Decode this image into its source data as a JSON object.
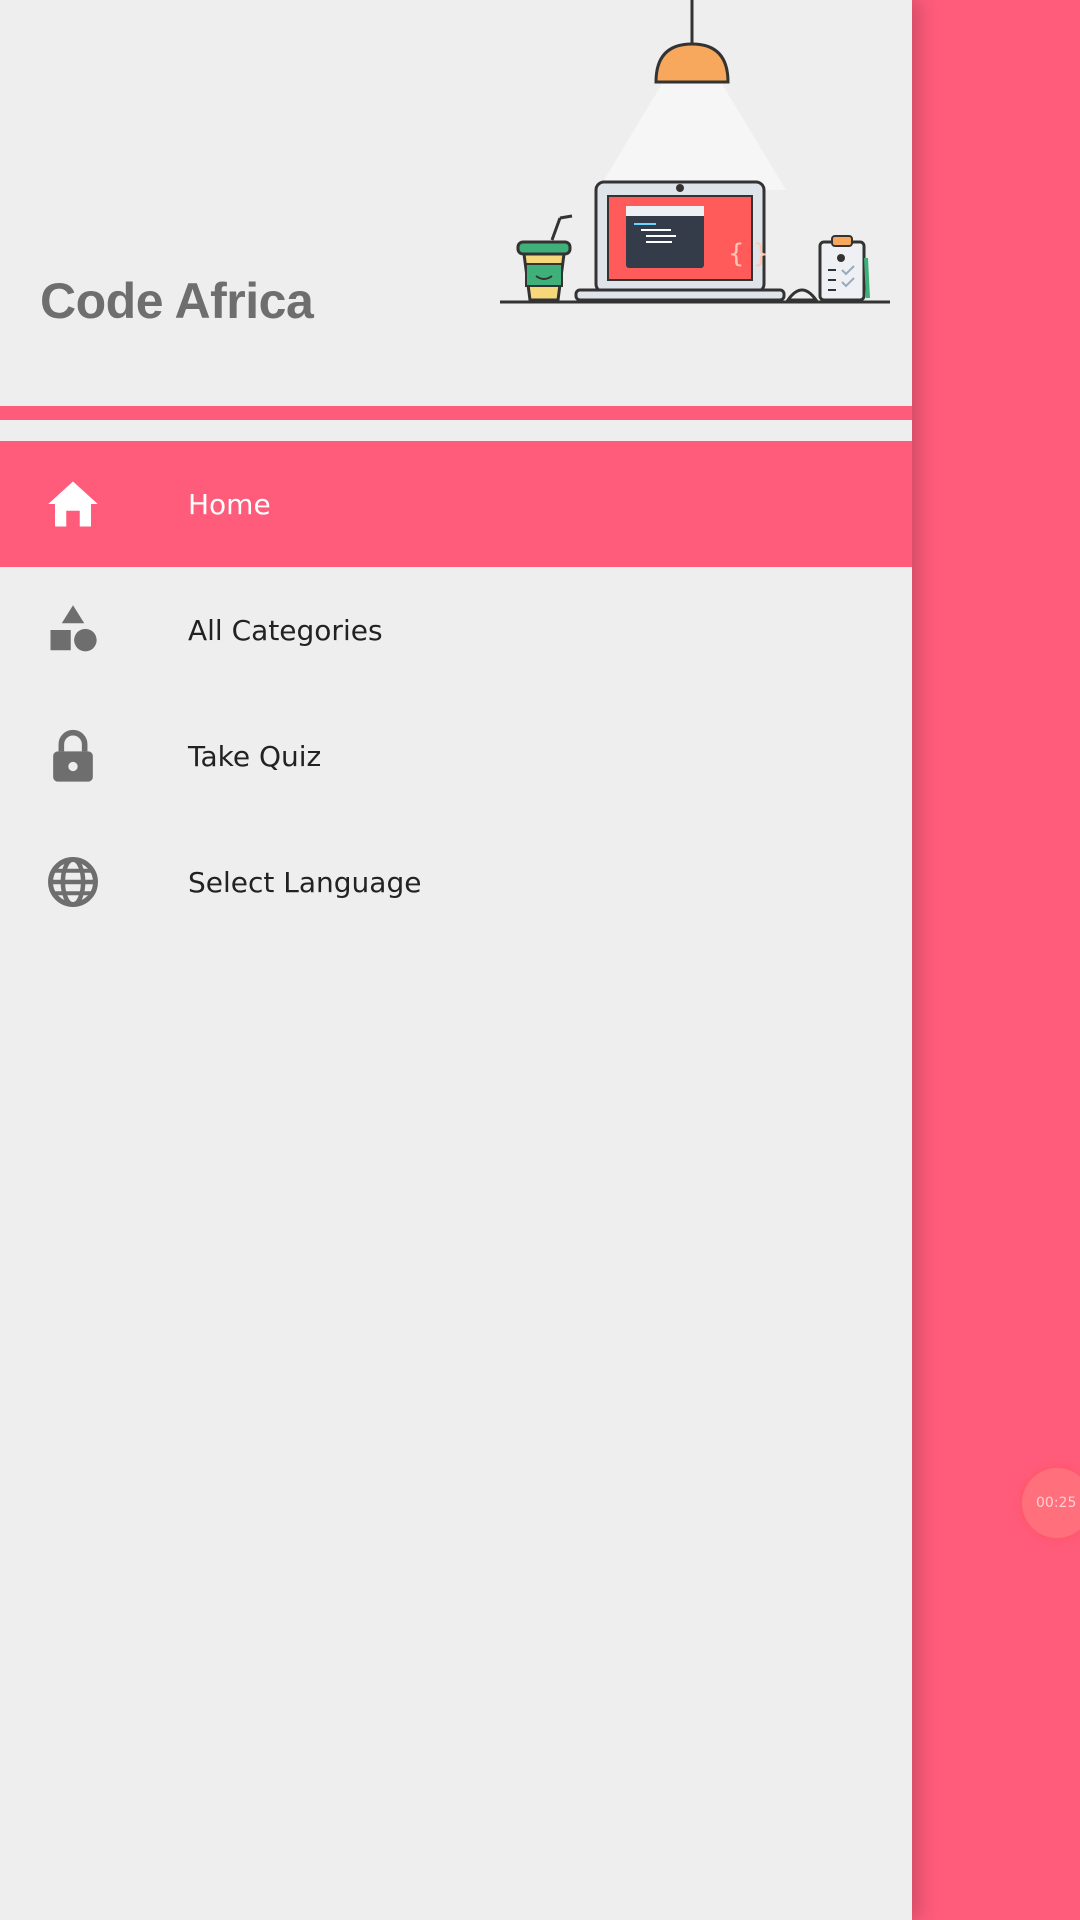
{
  "app": {
    "title": "Code Africa"
  },
  "menu": {
    "items": [
      {
        "label": "Home",
        "icon": "home-icon",
        "active": true
      },
      {
        "label": "All Categories",
        "icon": "shapes-icon",
        "active": false
      },
      {
        "label": "Take Quiz",
        "icon": "lock-icon",
        "active": false
      },
      {
        "label": "Select Language",
        "icon": "globe-icon",
        "active": false
      }
    ]
  },
  "timer": {
    "text": "00:25"
  },
  "colors": {
    "accent": "#ff5c7b",
    "drawer_bg": "#eeeeef",
    "icon_gray": "#6e6e6e"
  }
}
